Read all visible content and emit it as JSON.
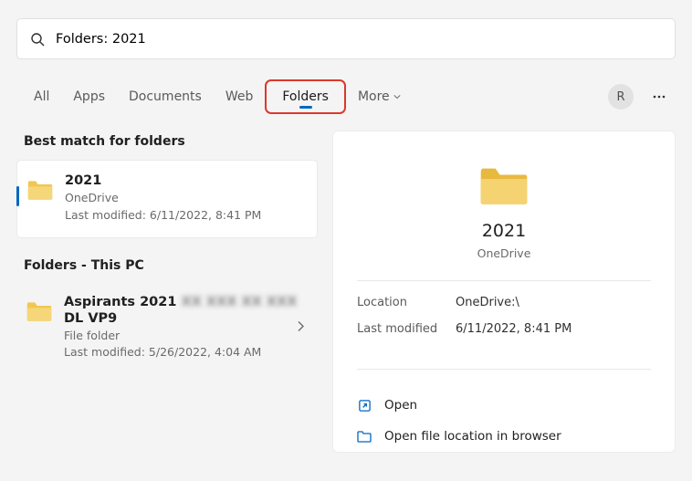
{
  "search": {
    "value": "Folders: 2021"
  },
  "tabs": {
    "all": "All",
    "apps": "Apps",
    "documents": "Documents",
    "web": "Web",
    "folders": "Folders",
    "more": "More"
  },
  "avatar_initial": "R",
  "sections": {
    "best_match": "Best match for folders",
    "this_pc": "Folders - This PC"
  },
  "results": {
    "best": {
      "title": "2021",
      "source": "OneDrive",
      "modified": "Last modified: 6/11/2022, 8:41 PM"
    },
    "other": {
      "title": "Aspirants 2021",
      "line2": "DL VP9",
      "type": "File folder",
      "modified": "Last modified: 5/26/2022, 4:04 AM"
    }
  },
  "preview": {
    "title": "2021",
    "source": "OneDrive",
    "location_label": "Location",
    "location_value": "OneDrive:\\",
    "modified_label": "Last modified",
    "modified_value": "6/11/2022, 8:41 PM",
    "action_open": "Open",
    "action_open_location": "Open file location in browser"
  }
}
